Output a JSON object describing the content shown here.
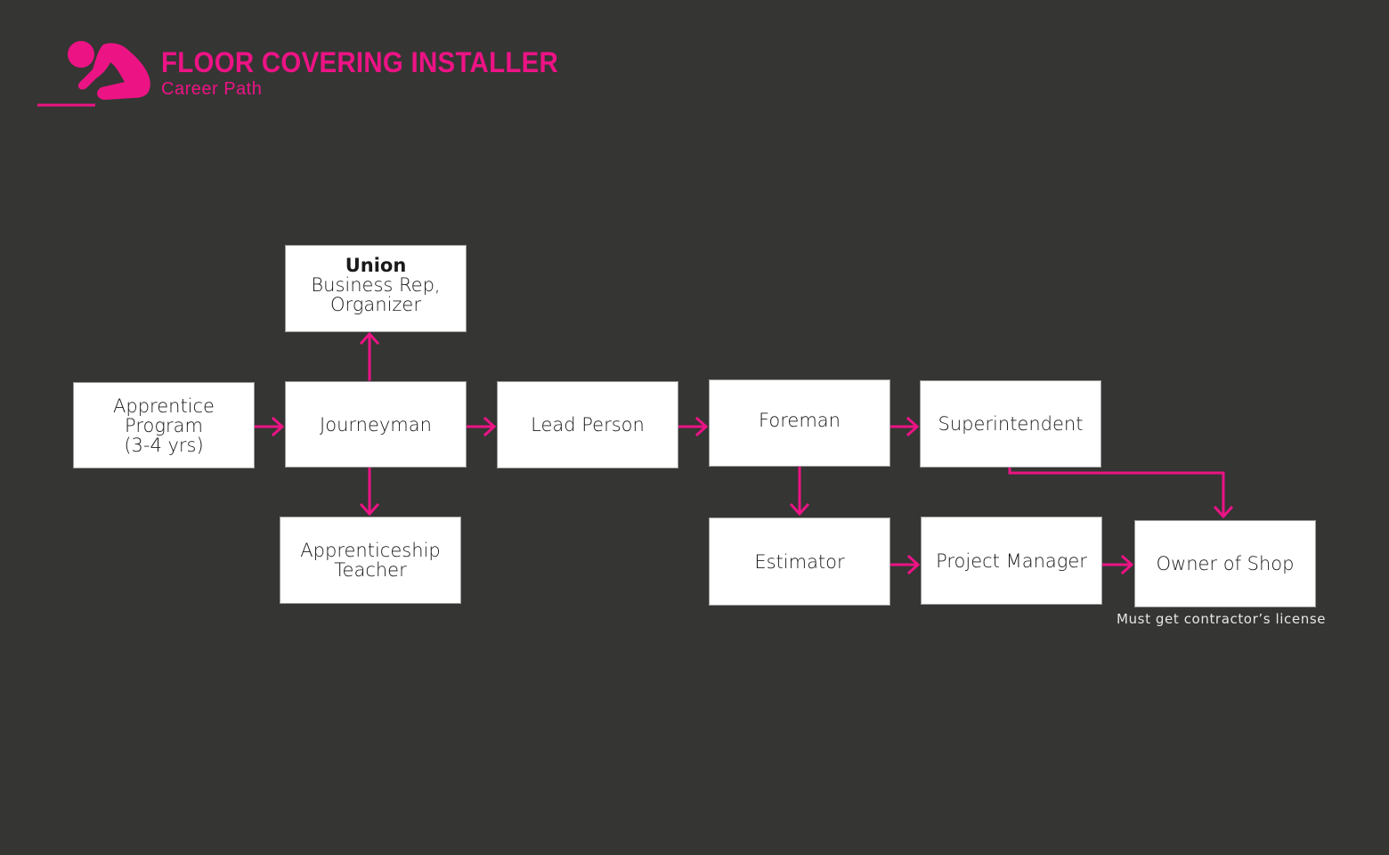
{
  "header": {
    "title": "FLOOR COVERING INSTALLER",
    "subtitle": "Career Path",
    "logo_icon": "kneeling-installer-icon"
  },
  "colors": {
    "background": "#353533",
    "accent": "#ec1385",
    "box_fill": "#ffffff",
    "box_text": "#1a1a1a",
    "note_text": "#e6e6e6"
  },
  "nodes": {
    "apprentice_program": {
      "lines": [
        "Apprentice",
        "Program",
        "(3-4 yrs)"
      ]
    },
    "journeyman": {
      "lines": [
        "Journeyman"
      ]
    },
    "union": {
      "bold": "Union",
      "lines": [
        "Business Rep,",
        "Organizer"
      ]
    },
    "apprenticeship_teacher": {
      "lines": [
        "Apprenticeship",
        "Teacher"
      ]
    },
    "lead_person": {
      "lines": [
        "Lead Person"
      ]
    },
    "foreman": {
      "lines": [
        "Foreman"
      ]
    },
    "superintendent": {
      "lines": [
        "Superintendent"
      ]
    },
    "estimator": {
      "lines": [
        "Estimator"
      ]
    },
    "project_manager": {
      "lines": [
        "Project Manager"
      ]
    },
    "owner_of_shop": {
      "lines": [
        "Owner of Shop"
      ]
    }
  },
  "edges": [
    {
      "from": "apprentice_program",
      "to": "journeyman"
    },
    {
      "from": "journeyman",
      "to": "union"
    },
    {
      "from": "journeyman",
      "to": "apprenticeship_teacher"
    },
    {
      "from": "journeyman",
      "to": "lead_person"
    },
    {
      "from": "lead_person",
      "to": "foreman"
    },
    {
      "from": "foreman",
      "to": "superintendent"
    },
    {
      "from": "foreman",
      "to": "estimator"
    },
    {
      "from": "superintendent",
      "to": "owner_of_shop"
    },
    {
      "from": "estimator",
      "to": "project_manager"
    },
    {
      "from": "project_manager",
      "to": "owner_of_shop"
    }
  ],
  "note": "Must get  contractor’s license"
}
